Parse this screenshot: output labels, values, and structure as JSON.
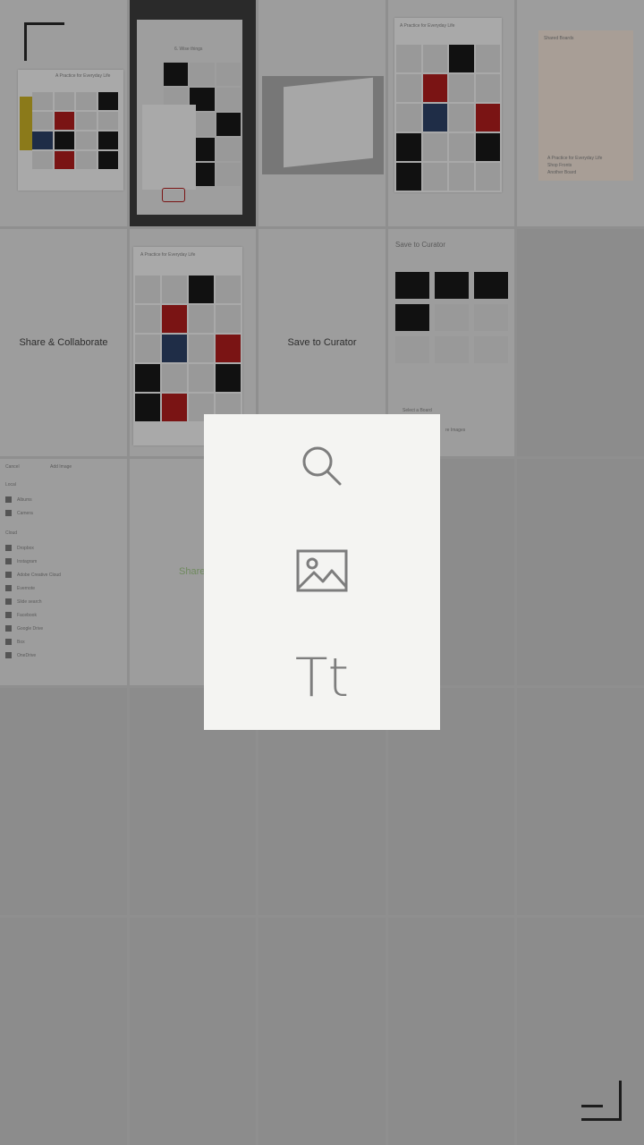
{
  "overlay": {
    "buttons": [
      {
        "icon": "search-icon"
      },
      {
        "icon": "image-icon"
      },
      {
        "icon": "text-icon",
        "label": "Tt"
      }
    ]
  },
  "thumbs": {
    "practice_title": "A Practice for Everyday Life",
    "share_label": "Share & Collaborate",
    "save_label": "Save to Curator",
    "save_header": "Save to Curator",
    "select_board": "Select a Board",
    "save_images": "re Images",
    "shared_boards": "Shared Boards",
    "board_items": [
      "A Practice for Everyday Life",
      "Shop Fronts",
      "Another Board"
    ],
    "wise_things": "6. Wise things",
    "add_image": {
      "cancel": "Cancel",
      "title": "Add Image",
      "local": "Local",
      "local_items": [
        "Albums",
        "Camera"
      ],
      "cloud": "Cloud",
      "cloud_items": [
        "Dropbox",
        "Instagram",
        "Adobe Creative Cloud",
        "Evernote",
        "Slide search",
        "Facebook",
        "Google Drive",
        "Box",
        "OneDrive"
      ]
    },
    "share_partial": "Share"
  }
}
